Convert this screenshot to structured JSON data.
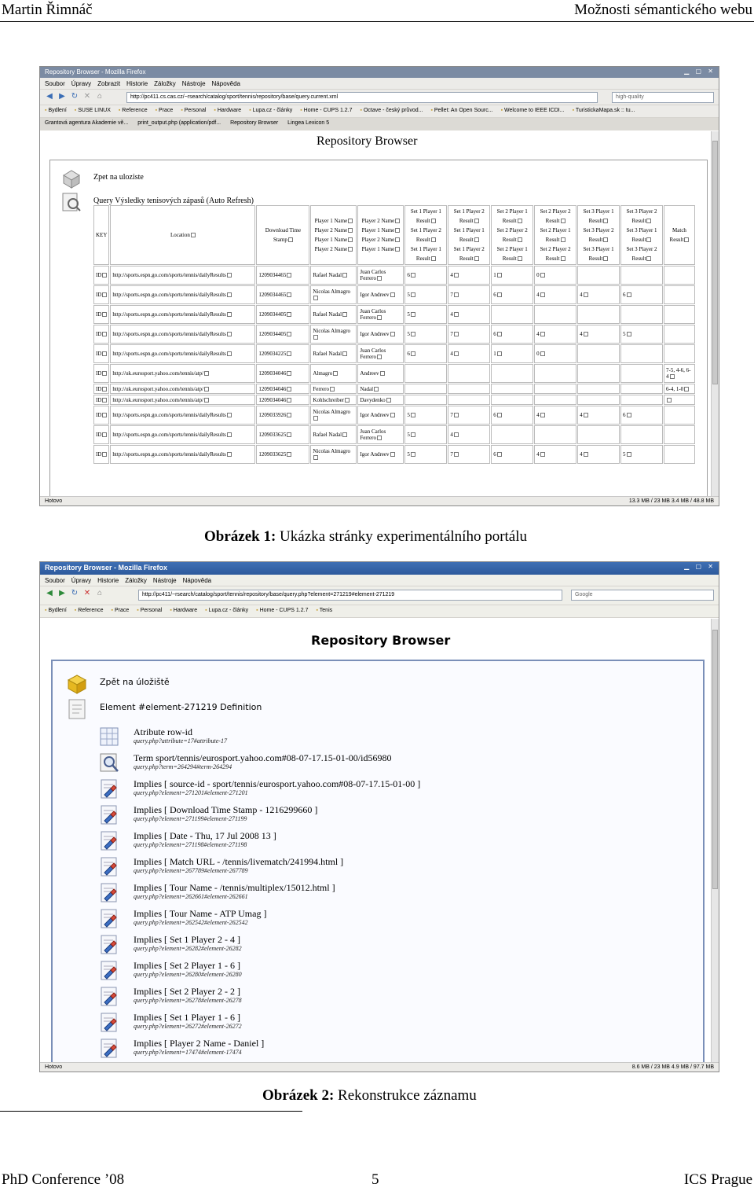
{
  "header": {
    "author": "Martin Řimnáč",
    "title": "Možnosti sémantického webu"
  },
  "figure1": {
    "window_title": "Repository Browser - Mozilla Firefox",
    "menu": [
      "Soubor",
      "Úpravy",
      "Zobrazit",
      "Historie",
      "Záložky",
      "Nástroje",
      "Nápověda"
    ],
    "url": "http://pc411.cs.cas.cz/~rsearch/catalog/sport/tennis/repository/base/query.current.xml",
    "search": "high-quality",
    "bookmarks": [
      "Bydlení",
      "SUSE LINUX",
      "Reference",
      "Prace",
      "Personal",
      "Hardware",
      "Lupa.cz - články",
      "Home - CUPS 1.2.7",
      "Octave - český průvod...",
      "Pellet: An Open Sourc...",
      "Welcome to IEEE ICDI...",
      "TuristickaMapa.sk :: tu..."
    ],
    "tabs": [
      "Grantová agentura Akademie vě...",
      "print_output.php (application/pdf...",
      "Repository Browser",
      "Lingea Lexicon 5"
    ],
    "page_title": "Repository Browser",
    "link_back": "Zpet na uloziste",
    "query_title": "Query Výsledky tenisových zápasů (Auto Refresh)",
    "col_key": "KEY",
    "col_location": "Location",
    "col_stamp": "Download Time Stamp",
    "col_p1": [
      "Player 1 Name",
      "Player 2 Name",
      "Player 1 Name",
      "Player 2 Name"
    ],
    "col_p2": [
      "Player 2 Name",
      "Player 1 Name",
      "Player 2 Name",
      "Player 1 Name"
    ],
    "set_cols": [
      [
        "Set 1 Player 1 Result",
        "Set 1 Player 2 Result",
        "Set 1 Player 1 Result"
      ],
      [
        "Set 1 Player 2 Result",
        "Set 1 Player 1 Result",
        "Set 1 Player 2 Result"
      ],
      [
        "Set 2 Player 1 Result",
        "Set 2 Player 2 Result",
        "Set 2 Player 1 Result"
      ],
      [
        "Set 2 Player 2 Result",
        "Set 2 Player 1 Result",
        "Set 2 Player 2 Result"
      ],
      [
        "Set 3 Player 1 Result",
        "Set 3 Player 2 Result",
        "Set 3 Player 1 Result"
      ],
      [
        "Set 3 Player 2 Result",
        "Set 3 Player 1 Result",
        "Set 3 Player 2 Result"
      ]
    ],
    "col_match": "Match Result",
    "rows": [
      {
        "id": "ID",
        "loc": "http://sports.espn.go.com/sports/tennis/dailyResults",
        "stamp": "1209034465",
        "p1": "Rafael Nadal",
        "p2": "Juan Carlos Ferrero",
        "s": [
          "6",
          "4",
          "1",
          "0",
          "",
          ""
        ],
        "m": ""
      },
      {
        "id": "ID",
        "loc": "http://sports.espn.go.com/sports/tennis/dailyResults",
        "stamp": "1209034465",
        "p1": "Nicolas Almagro",
        "p2": "Igor Andreev",
        "s": [
          "5",
          "7",
          "6",
          "4",
          "4",
          "6"
        ],
        "m": ""
      },
      {
        "id": "ID",
        "loc": "http://sports.espn.go.com/sports/tennis/dailyResults",
        "stamp": "1209034405",
        "p1": "Rafael Nadal",
        "p2": "Juan Carlos Ferrero",
        "s": [
          "5",
          "4",
          "",
          "",
          "",
          ""
        ],
        "m": ""
      },
      {
        "id": "ID",
        "loc": "http://sports.espn.go.com/sports/tennis/dailyResults",
        "stamp": "1209034405",
        "p1": "Nicolas Almagro",
        "p2": "Igor Andreev",
        "s": [
          "5",
          "7",
          "6",
          "4",
          "4",
          "5"
        ],
        "m": ""
      },
      {
        "id": "ID",
        "loc": "http://sports.espn.go.com/sports/tennis/dailyResults",
        "stamp": "1209034225",
        "p1": "Rafael Nadal",
        "p2": "Juan Carlos Ferrero",
        "s": [
          "6",
          "4",
          "1",
          "0",
          "",
          ""
        ],
        "m": ""
      },
      {
        "id": "ID",
        "loc": "http://uk.eurosport.yahoo.com/tennis/atp/",
        "stamp": "1209034046",
        "p1": "Almagro",
        "p2": "Andreev",
        "s": [
          "",
          "",
          "",
          "",
          "",
          ""
        ],
        "m": "7-5, 4-6, 6-4"
      },
      {
        "id": "ID",
        "loc": "http://uk.eurosport.yahoo.com/tennis/atp/",
        "stamp": "1209034046",
        "p1": "Ferrero",
        "p2": "Nadal",
        "s": [
          "",
          "",
          "",
          "",
          "",
          ""
        ],
        "m": "6-4, 1-0",
        "short": true
      },
      {
        "id": "ID",
        "loc": "http://uk.eurosport.yahoo.com/tennis/atp/",
        "stamp": "1209034046",
        "p1": "Kohlschreiber",
        "p2": "Davydenko",
        "s": [
          "",
          "",
          "",
          "",
          "",
          ""
        ],
        "m": "",
        "short": true
      },
      {
        "id": "ID",
        "loc": "http://sports.espn.go.com/sports/tennis/dailyResults",
        "stamp": "1209033926",
        "p1": "Nicolas Almagro",
        "p2": "Igor Andreev",
        "s": [
          "5",
          "7",
          "6",
          "4",
          "4",
          "6"
        ],
        "m": ""
      },
      {
        "id": "ID",
        "loc": "http://sports.espn.go.com/sports/tennis/dailyResults",
        "stamp": "1209033625",
        "p1": "Rafael Nadal",
        "p2": "Juan Carlos Ferrero",
        "s": [
          "5",
          "4",
          "",
          "",
          "",
          ""
        ],
        "m": ""
      },
      {
        "id": "ID",
        "loc": "http://sports.espn.go.com/sports/tennis/dailyResults",
        "stamp": "1209033625",
        "p1": "Nicolas Almagro",
        "p2": "Igor Andreev",
        "s": [
          "5",
          "7",
          "6",
          "4",
          "4",
          "5"
        ],
        "m": ""
      }
    ],
    "status_left": "Hotovo",
    "status_right": "13.3 MB / 23 MB   3.4 MB / 48.8 MB",
    "caption_label": "Obrázek 1:",
    "caption_text": "Ukázka stránky experimentálního portálu"
  },
  "figure2": {
    "window_title": "Repository Browser - Mozilla Firefox",
    "menu": [
      "Soubor",
      "Úpravy",
      "Historie",
      "Záložky",
      "Nástroje",
      "Nápověda"
    ],
    "url": "http://pc411/~rsearch/catalog/sport/tennis/repository/base/query.php?element=271219#element-271219",
    "search": "Google",
    "bookmarks": [
      "Bydlení",
      "Reference",
      "Prace",
      "Personal",
      "Hardware",
      "Lupa.cz - články",
      "Home - CUPS 1.2.7",
      "Tenis"
    ],
    "page_title": "Repository Browser",
    "link_back": "Zpět na úložiště",
    "element_def": "Element #element-271219 Definition",
    "items": [
      {
        "main": "Atribute row-id",
        "sub": "query.php?attribute=17#attribute-17",
        "icon": "table"
      },
      {
        "main": "Term sport/tennis/eurosport.yahoo.com#08-07-17.15-01-00/id56980",
        "sub": "query.php?term=264294#term-264294",
        "icon": "search"
      },
      {
        "main": "Implies [ source-id - sport/tennis/eurosport.yahoo.com#08-07-17.15-01-00 ]",
        "sub": "query.php?element=271201#element-271201",
        "icon": "doc"
      },
      {
        "main": "Implies [ Download Time Stamp - 1216299660 ]",
        "sub": "query.php?element=271199#element-271199",
        "icon": "doc"
      },
      {
        "main": "Implies [ Date - Thu, 17 Jul 2008 13 ]",
        "sub": "query.php?element=271198#element-271198",
        "icon": "doc"
      },
      {
        "main": "Implies [ Match URL - /tennis/livematch/241994.html ]",
        "sub": "query.php?element=267789#element-267789",
        "icon": "doc"
      },
      {
        "main": "Implies [ Tour Name - /tennis/multiplex/15012.html ]",
        "sub": "query.php?element=262661#element-262661",
        "icon": "doc"
      },
      {
        "main": "Implies [ Tour Name - ATP Umag ]",
        "sub": "query.php?element=262542#element-262542",
        "icon": "doc"
      },
      {
        "main": "Implies [ Set 1 Player 2 - 4 ]",
        "sub": "query.php?element=26282#element-26282",
        "icon": "doc"
      },
      {
        "main": "Implies [ Set 2 Player 1 - 6 ]",
        "sub": "query.php?element=26280#element-26280",
        "icon": "doc"
      },
      {
        "main": "Implies [ Set 2 Player 2 - 2 ]",
        "sub": "query.php?element=26278#element-26278",
        "icon": "doc"
      },
      {
        "main": "Implies [ Set 1 Player 1 - 6 ]",
        "sub": "query.php?element=26272#element-26272",
        "icon": "doc"
      },
      {
        "main": "Implies [ Player 2 Name - Daniel ]",
        "sub": "query.php?element=17474#element-17474",
        "icon": "doc"
      }
    ],
    "status_left": "Hotovo",
    "status_right": "8.6 MB / 23 MB   4.9 MB / 97.7 MB",
    "caption_label": "Obrázek 2:",
    "caption_text": "Rekonstrukce záznamu"
  },
  "footer": {
    "left": "PhD Conference ’08",
    "center": "5",
    "right": "ICS Prague"
  }
}
